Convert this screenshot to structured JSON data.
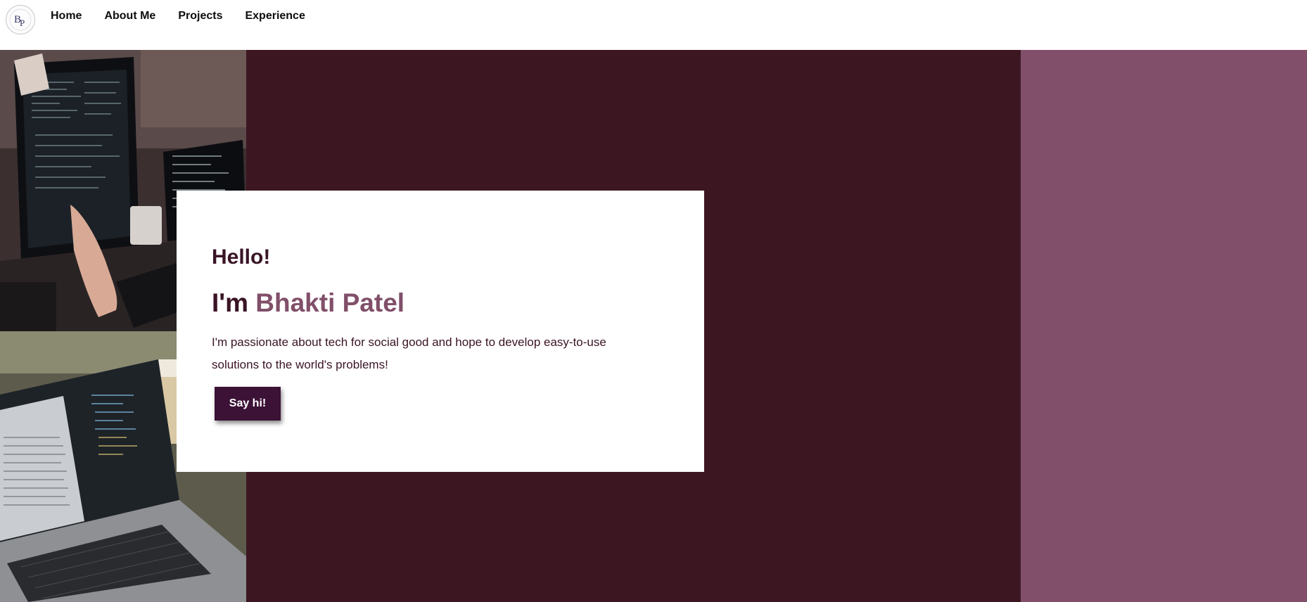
{
  "nav": {
    "logo_icon": "bp-monogram-logo-icon",
    "links": [
      "Home",
      "About Me",
      "Projects",
      "Experience"
    ]
  },
  "hero": {
    "greeting": "Hello!",
    "name_prefix": "I'm",
    "name": "Bhakti Patel",
    "tagline": "I'm passionate about tech for social good and hope to develop easy-to-use solutions to the world's problems!",
    "cta_label": "Say hi!",
    "images": [
      "desk-monitors-photo",
      "laptop-code-photo"
    ]
  },
  "colors": {
    "dark_panel": "#3c1722",
    "mauve_panel": "#814f69",
    "accent": "#814f69",
    "text": "#3a1426",
    "button": "#3c1236"
  }
}
